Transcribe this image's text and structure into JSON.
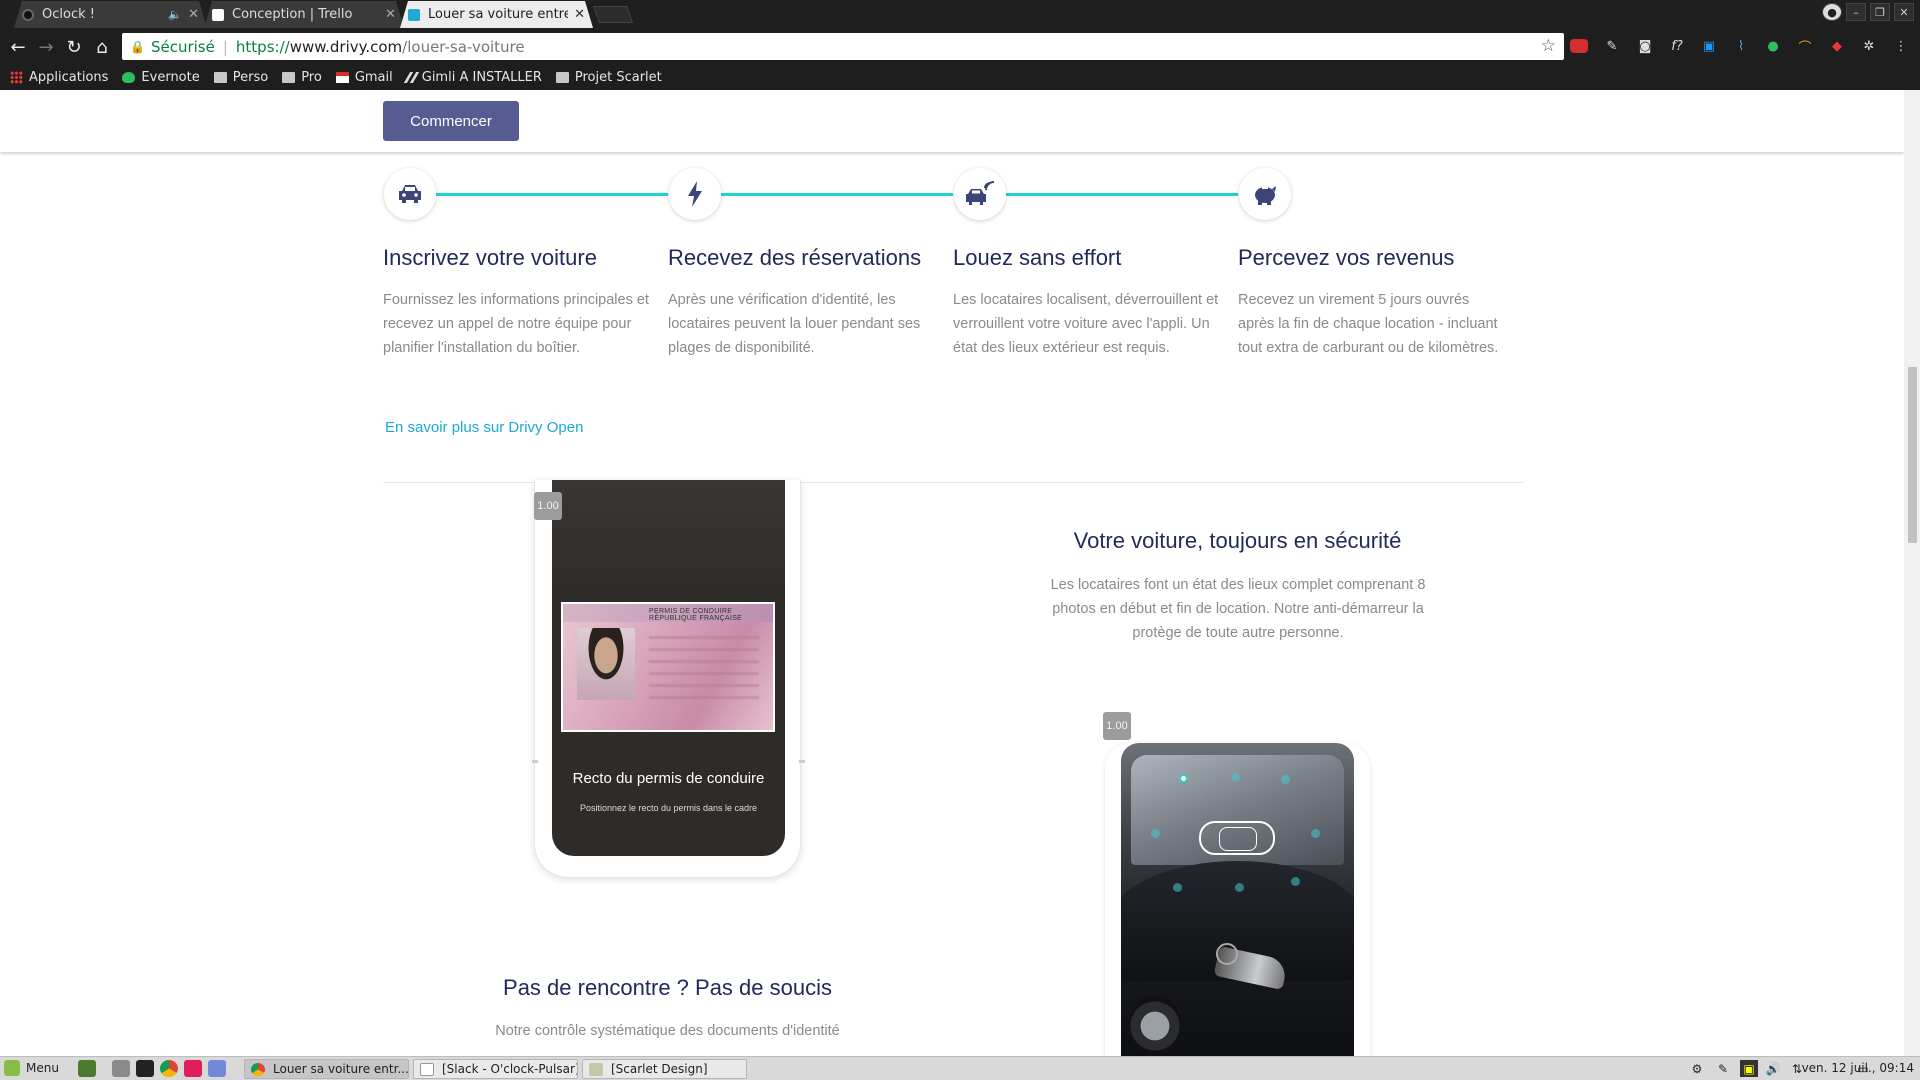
{
  "browser": {
    "tabs": [
      {
        "title": "Oclock !",
        "muted": "🔈"
      },
      {
        "title": "Conception | Trello"
      },
      {
        "title": "Louer sa voiture entre p"
      }
    ],
    "address": {
      "secure_label": "Sécurisé",
      "protocol": "https://",
      "host": "www.drivy.com",
      "path": "/louer-sa-voiture"
    },
    "bookmarks": [
      "Applications",
      "Evernote",
      "Perso",
      "Pro",
      "Gmail",
      "Gimli A INSTALLER",
      "Projet Scarlet"
    ]
  },
  "page": {
    "start_button": "Commencer",
    "steps": [
      {
        "icon": "car-icon",
        "title": "Inscrivez votre voiture",
        "desc": "Fournissez les informations principales et recevez un appel de notre équipe pour planifier l'installation du boîtier."
      },
      {
        "icon": "lightning-icon",
        "title": "Recevez des réservations",
        "desc": "Après une vérification d'identité, les locataires peuvent la louer pendant ses plages de disponibilité."
      },
      {
        "icon": "connected-car-icon",
        "title": "Louez sans effort",
        "desc": "Les locataires localisent, déverrouillent et verrouillent votre voiture avec l'appli. Un état des lieux extérieur est requis."
      },
      {
        "icon": "piggy-bank-icon",
        "title": "Percevez vos revenus",
        "desc": "Recevez un virement 5 jours ouvrés après la fin de chaque location - incluant tout extra de carburant ou de kilomètres."
      }
    ],
    "more_link": "En savoir plus sur Drivy Open",
    "phone_demo": {
      "badge": "1.00",
      "card_header": "PERMIS DE CONDUIRE   RÉPUBLIQUE FRANÇAISE",
      "caption": "Recto du permis de conduire",
      "subcaption": "Positionnez le recto du permis dans le cadre"
    },
    "security": {
      "title": "Votre voiture, toujours en sécurité",
      "desc": "Les locataires font un état des lieux complet comprenant 8 photos en début et fin de location. Notre anti-démarreur la protège de toute autre personne.",
      "badge": "1.00"
    },
    "no_meeting": {
      "title": "Pas de rencontre ? Pas de soucis",
      "desc": "Notre contrôle systématique des documents d'identité"
    },
    "colors": {
      "accent": "#565c91",
      "line": "#1fd3d3",
      "link": "#1ca8d8",
      "heading": "#232a5a"
    }
  },
  "taskbar": {
    "menu": "Menu",
    "tasks": [
      "Louer sa voiture entr...",
      "[Slack - O'clock-Pulsar]",
      "[Scarlet Design]"
    ],
    "clock": "ven. 12 juil., 09:14"
  }
}
